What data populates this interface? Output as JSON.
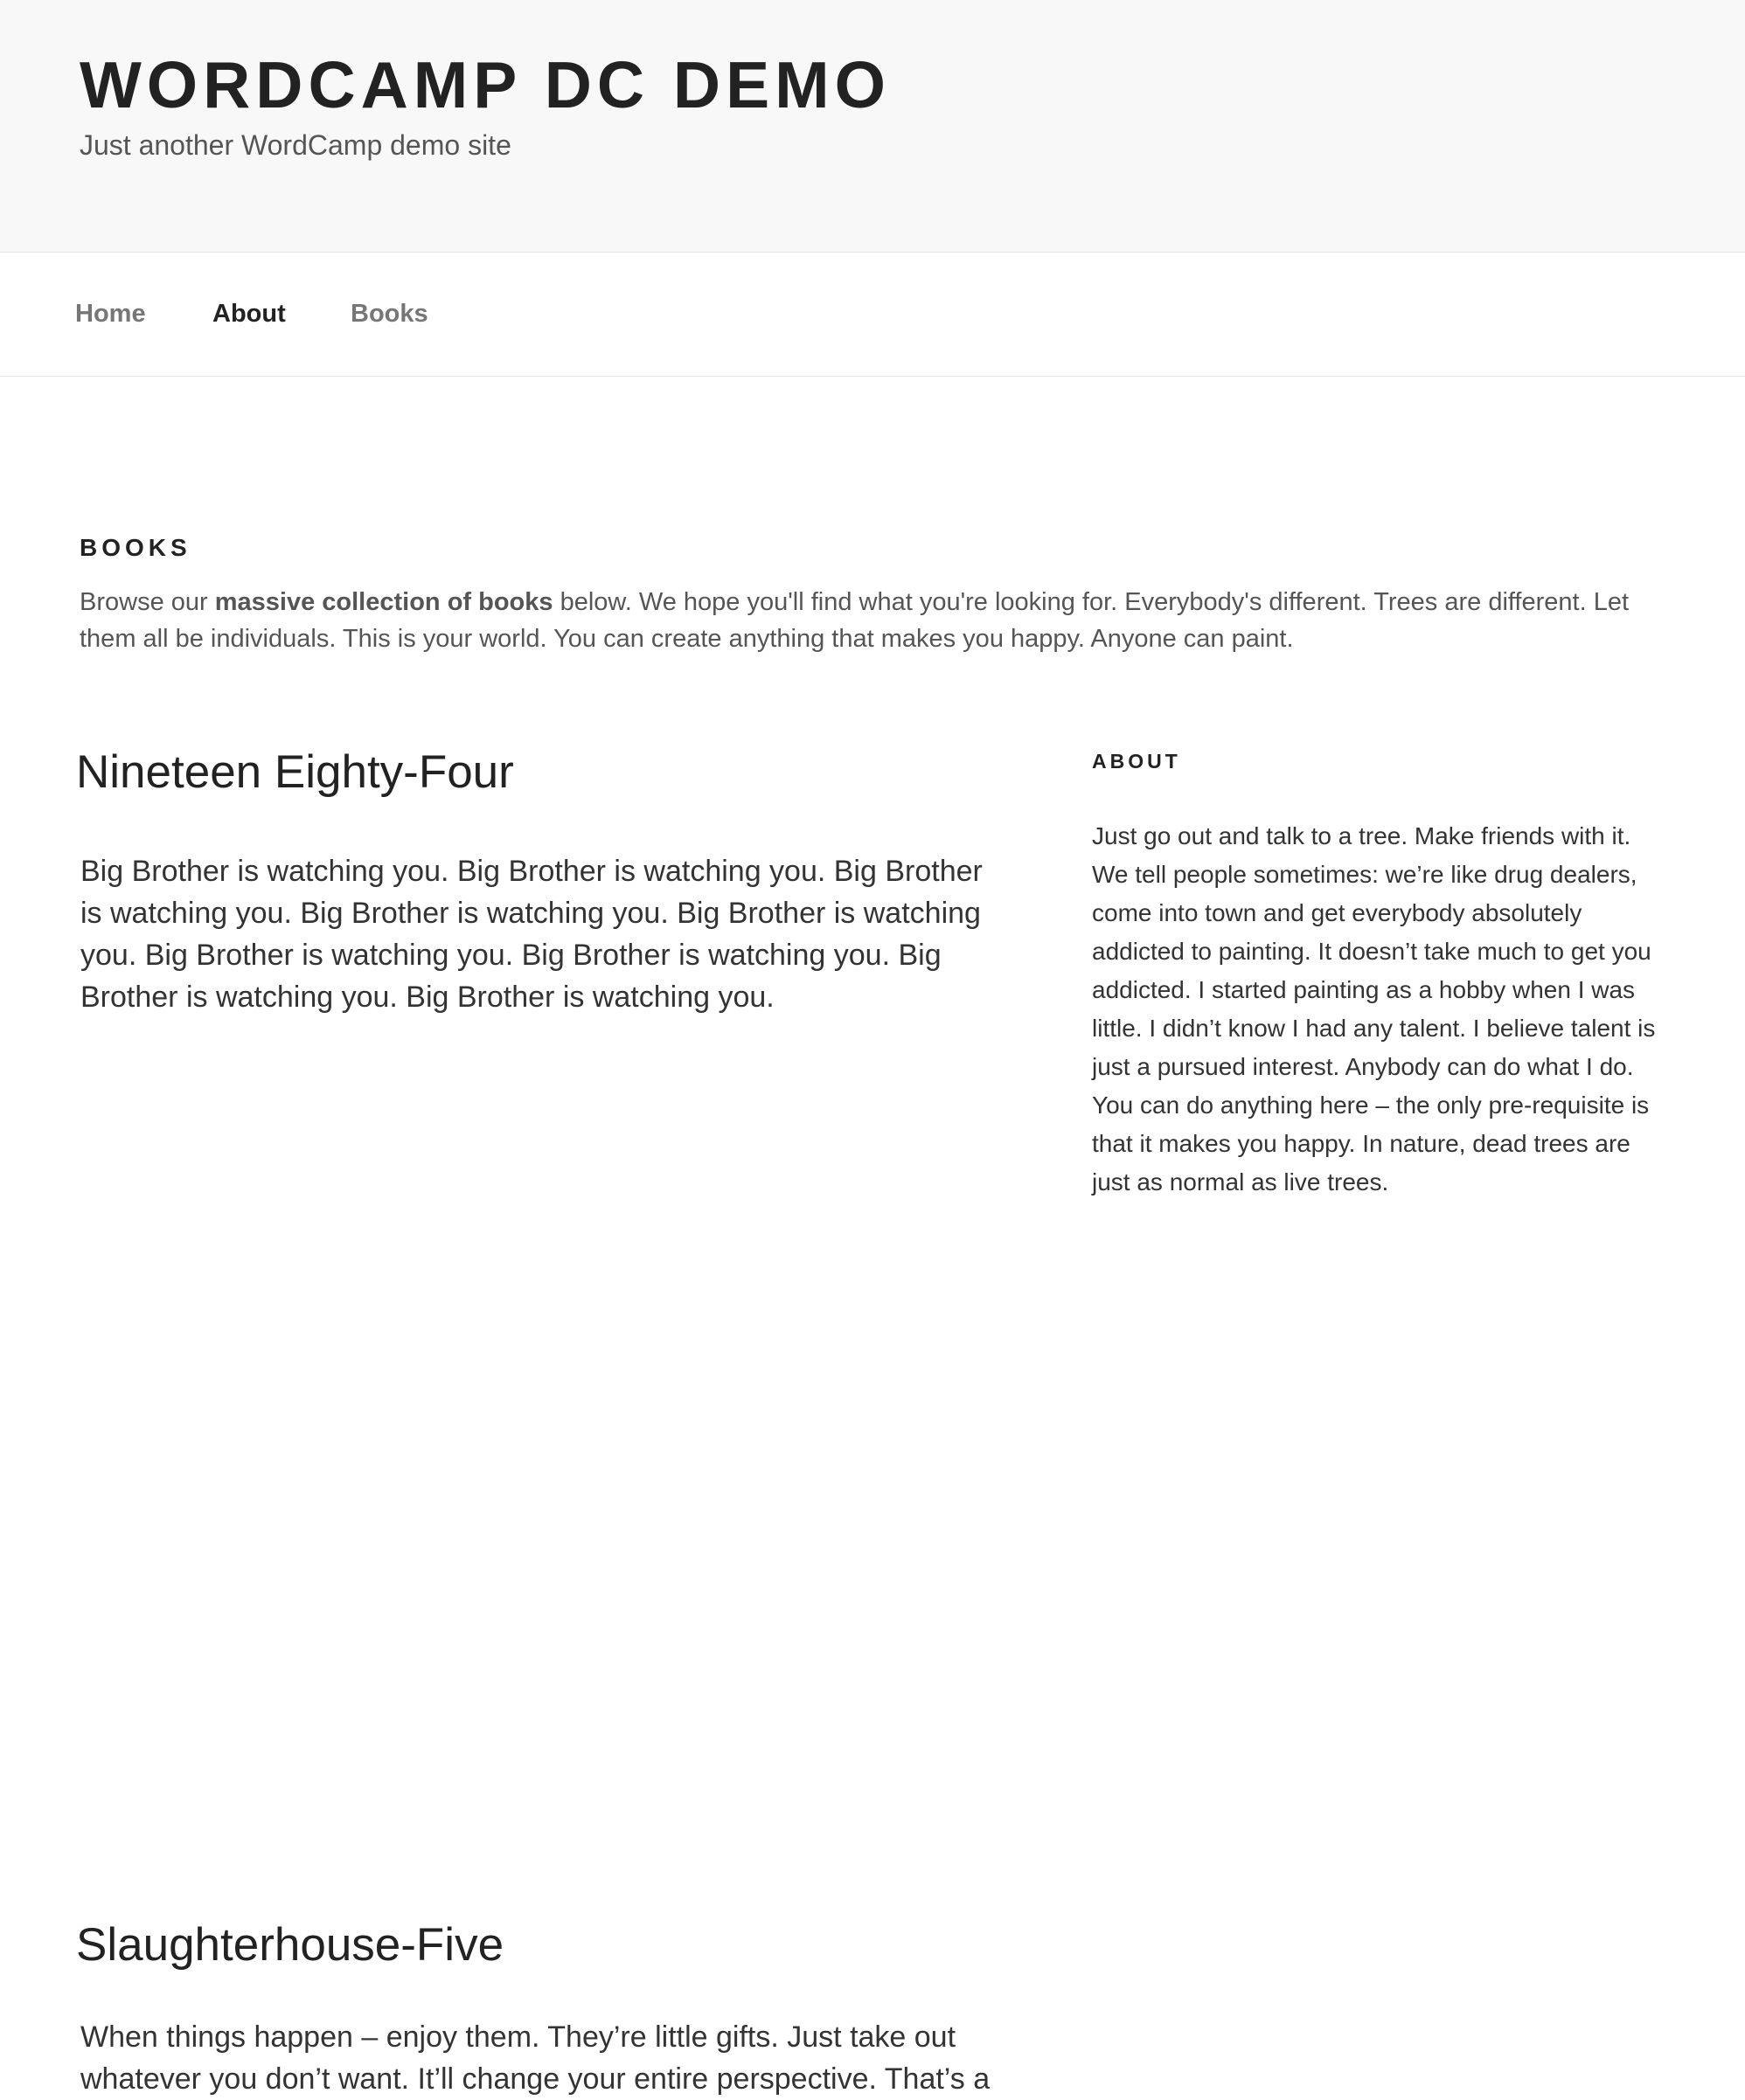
{
  "header": {
    "site_title": "WORDCAMP DC DEMO",
    "tagline": "Just another WordCamp demo site"
  },
  "nav": {
    "items": [
      {
        "label": "Home",
        "current": false
      },
      {
        "label": "About",
        "current": true
      },
      {
        "label": "Books",
        "current": false
      }
    ]
  },
  "page": {
    "heading": "BOOKS",
    "intro_before": "Browse our ",
    "intro_bold": "massive collection of books",
    "intro_after": " below. We hope you'll find what you're looking for. Everybody's different. Trees are different. Let them all be individuals. This is your world. You can create anything that makes you happy. Anyone can paint."
  },
  "books": [
    {
      "title": "Nineteen Eighty-Four",
      "text": "Big Brother is watching you. Big Brother is watching you. Big Brother is watching you. Big Brother is watching you. Big Brother is watching you. Big Brother is watching you. Big Brother is watching you. Big Brother is watching you. Big Brother is watching you."
    },
    {
      "title": "Slaughterhouse-Five",
      "text": "When things happen – enjoy them. They’re little gifts. Just take out whatever you don’t want. It’ll change your entire perspective. That’s a"
    }
  ],
  "sidebar": {
    "widget_title": "ABOUT",
    "widget_text": "Just go out and talk to a tree. Make friends with it. We tell people sometimes: we’re like drug dealers, come into town and get everybody absolutely addicted to painting. It doesn’t take much to get you addicted. I started painting as a hobby when I was little. I didn’t know I had any talent. I believe talent is just a pursued interest. Anybody can do what I do. You can do anything here – the only pre-requisite is that it makes you happy. In nature, dead trees are just as normal as live trees."
  }
}
